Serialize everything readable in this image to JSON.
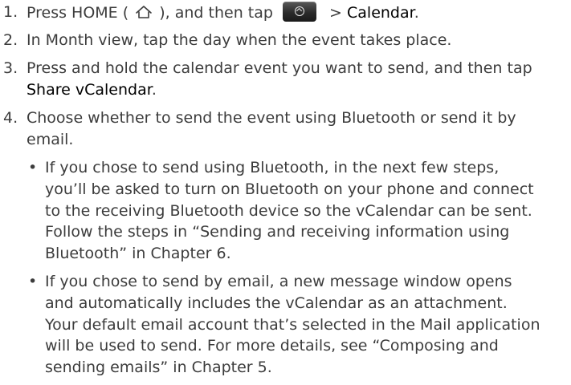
{
  "steps": [
    {
      "number": "1.",
      "text_before_icon": "Press HOME (",
      "text_after_icon": "), and then tap",
      "sep": ">",
      "link": "Calendar",
      "end": "."
    },
    {
      "number": "2.",
      "text": "In Month view, tap the day when the event takes place."
    },
    {
      "number": "3.",
      "text": "Press and hold the calendar event you want to send, and then tap",
      "link": "Share vCalendar",
      "end": "."
    },
    {
      "number": "4.",
      "text": "Choose whether to send the event using Bluetooth or send it by email.",
      "bullets": [
        {
          "marker": "•",
          "text": "If you chose to send using Bluetooth, in the next few steps, you’ll be asked to turn on Bluetooth on your phone and connect to the receiving Bluetooth device so the vCalendar can be sent. Follow the steps in “Sending and receiving information using Bluetooth” in Chapter 6."
        },
        {
          "marker": "•",
          "text": "If you chose to send by email, a new message window opens and automatically includes the vCalendar as an attachment. Your default email account that’s selected in the Mail application will be used to send. For more details, see “Composing and sending emails” in Chapter 5."
        }
      ]
    }
  ],
  "icons": {
    "home": "home-outline-icon",
    "app_launcher": "app-launcher-button-icon"
  }
}
